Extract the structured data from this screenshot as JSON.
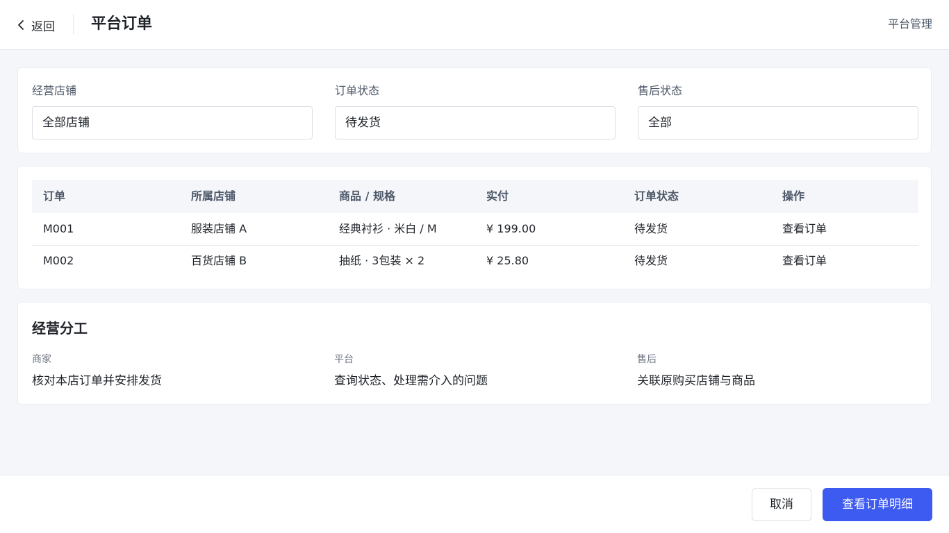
{
  "header": {
    "back_label": "返回",
    "title": "平台订单",
    "right_link": "平台管理"
  },
  "filters": [
    {
      "label": "经营店铺",
      "value": "全部店铺"
    },
    {
      "label": "订单状态",
      "value": "待发货"
    },
    {
      "label": "售后状态",
      "value": "全部"
    }
  ],
  "table": {
    "columns": [
      "订单",
      "所属店铺",
      "商品 / 规格",
      "实付",
      "订单状态",
      "操作"
    ],
    "rows": [
      {
        "order": "M001",
        "store": "服装店铺 A",
        "product": "经典衬衫 · 米白 / M",
        "paid": "¥ 199.00",
        "status": "待发货",
        "action": "查看订单"
      },
      {
        "order": "M002",
        "store": "百货店铺 B",
        "product": "抽纸 · 3包装 × 2",
        "paid": "¥ 25.80",
        "status": "待发货",
        "action": "查看订单"
      }
    ]
  },
  "division": {
    "title": "经营分工",
    "items": [
      {
        "role": "商家",
        "text": "核对本店订单并安排发货"
      },
      {
        "role": "平台",
        "text": "查询状态、处理需介入的问题"
      },
      {
        "role": "售后",
        "text": "关联原购买店铺与商品"
      }
    ]
  },
  "footer": {
    "cancel_label": "取消",
    "primary_label": "查看订单明细"
  },
  "colors": {
    "primary": "#3d5af1",
    "page_background": "#f4f6f9"
  },
  "icons": {
    "back": "chevron-left-icon"
  }
}
